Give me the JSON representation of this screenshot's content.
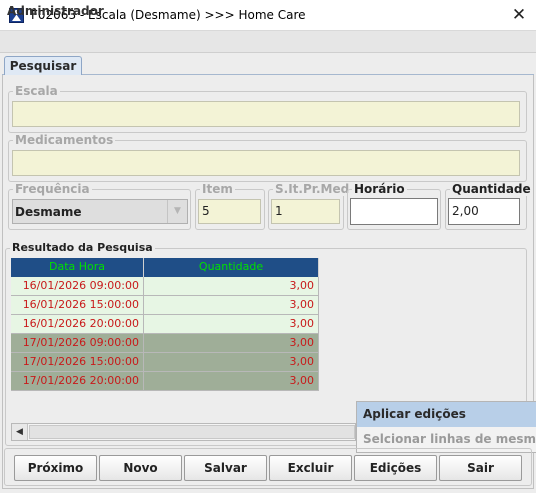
{
  "window": {
    "title": "F02063 - Escala (Desmame) >>> Home Care",
    "close_glyph": "✕"
  },
  "user": {
    "label": "Administrador"
  },
  "tabs": [
    {
      "label": "Pesquisar"
    }
  ],
  "form": {
    "escala": {
      "label": "Escala",
      "value": ""
    },
    "medicamentos": {
      "label": "Medicamentos",
      "value": ""
    },
    "frequencia": {
      "label": "Frequência",
      "value": "Desmame"
    },
    "item": {
      "label": "Item",
      "value": "5"
    },
    "slt": {
      "label": "S.It.Pr.Med",
      "value": "1"
    },
    "horario": {
      "label": "Horário",
      "value": ""
    },
    "quantidade": {
      "label": "Quantidade",
      "value": "2,00"
    }
  },
  "results": {
    "title": "Resultado da Pesquisa",
    "columns": [
      "Data Hora",
      "Quantidade"
    ],
    "rows": [
      {
        "datahora": "16/01/2026 09:00:00",
        "quantidade": "3,00"
      },
      {
        "datahora": "16/01/2026 15:00:00",
        "quantidade": "3,00"
      },
      {
        "datahora": "16/01/2026 20:00:00",
        "quantidade": "3,00"
      },
      {
        "datahora": "17/01/2026 09:00:00",
        "quantidade": "3,00"
      },
      {
        "datahora": "17/01/2026 15:00:00",
        "quantidade": "3,00"
      },
      {
        "datahora": "17/01/2026 20:00:00",
        "quantidade": "3,00"
      }
    ]
  },
  "context_menu": {
    "items": [
      {
        "label": "Aplicar edições"
      },
      {
        "label": "Selcionar linhas de mesmo horário"
      }
    ]
  },
  "buttons": {
    "proximo": "Próximo",
    "novo": "Novo",
    "salvar": "Salvar",
    "excluir": "Excluir",
    "edicoes": "Edições",
    "sair": "Sair"
  },
  "colors": {
    "header_bg": "#1f4e87",
    "header_text": "#00e000",
    "row_light": "#e7f6e4",
    "row_dark": "#9fae98",
    "cell_text": "#c81a1a",
    "field_disabled": "#f3f3d6",
    "menu_highlight": "#b8cfe8"
  }
}
